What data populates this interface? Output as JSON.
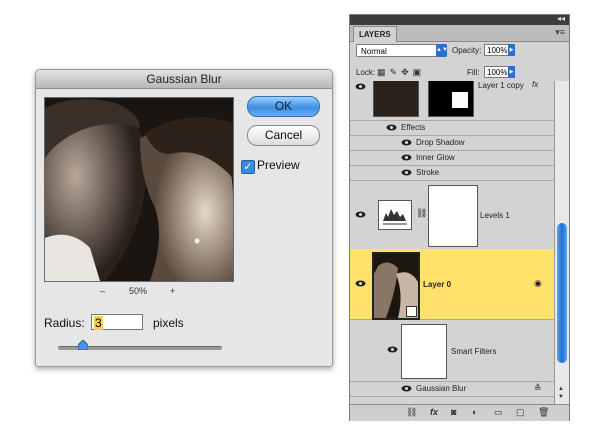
{
  "gaussian_blur": {
    "title": "Gaussian Blur",
    "ok_label": "OK",
    "cancel_label": "Cancel",
    "preview_label": "Preview",
    "preview_checked": true,
    "zoom_out": "–",
    "zoom_level": "50%",
    "zoom_in": "+",
    "radius_label": "Radius:",
    "radius_value": "3",
    "radius_units": "pixels",
    "slider_fraction": 0.15
  },
  "layers_panel": {
    "tab_label": "LAYERS",
    "blend_mode": "Normal",
    "opacity_label": "Opacity:",
    "opacity_value": "100%",
    "lock_label": "Lock:",
    "fill_label": "Fill:",
    "fill_value": "100%",
    "layers": [
      {
        "name": "Layer 1 copy",
        "fx": "fx"
      },
      {
        "name": "Effects"
      },
      {
        "name": "Drop Shadow"
      },
      {
        "name": "Inner Glow"
      },
      {
        "name": "Stroke"
      },
      {
        "name": "Levels 1"
      },
      {
        "name": "Layer 0",
        "selected": true
      },
      {
        "name": "Smart Filters"
      },
      {
        "name": "Gaussian Blur"
      }
    ],
    "accent_selected": "#ffe26b",
    "accent_blue": "#2f6ed1"
  }
}
